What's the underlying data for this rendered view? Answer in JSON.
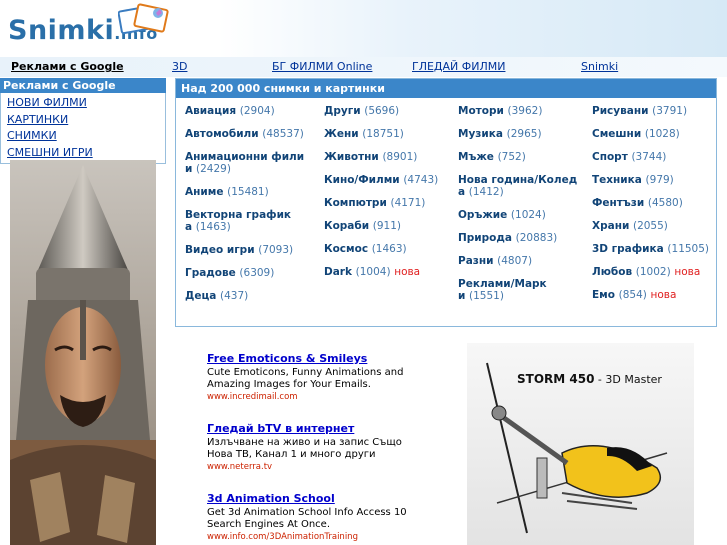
{
  "header": {
    "logo_main": "Snimki",
    "logo_tld": ".info"
  },
  "nav": {
    "ads": "Реклами с Google",
    "links": [
      "3D",
      "БГ ФИЛМИ Online",
      "ГЛЕДАЙ ФИЛМИ",
      "Snimki"
    ]
  },
  "sidebar": {
    "ads": "Реклами с Google",
    "items": [
      "НОВИ ФИЛМИ",
      "КАРТИНКИ",
      "СНИМКИ",
      "СМЕШНИ ИГРИ"
    ]
  },
  "panel": {
    "title": "Над 200 000 снимки и картинки",
    "columns": [
      [
        {
          "name": "Авиация",
          "count": "(2904)"
        },
        {
          "name": "Автомобили",
          "count": "(48537)"
        },
        {
          "name": "Анимационни фили",
          "name2": "и",
          "count": "(2429)"
        },
        {
          "name": "Аниме",
          "count": "(15481)"
        },
        {
          "name": "Векторна график",
          "name2": "а",
          "count": "(1463)"
        },
        {
          "name": "Видео игри",
          "count": "(7093)"
        },
        {
          "name": "Градове",
          "count": "(6309)"
        },
        {
          "name": "Деца",
          "count": "(437)"
        }
      ],
      [
        {
          "name": "Други",
          "count": "(5696)"
        },
        {
          "name": "Жени",
          "count": "(18751)"
        },
        {
          "name": "Животни",
          "count": "(8901)"
        },
        {
          "name": "Кино/Филми",
          "count": "(4743)"
        },
        {
          "name": "Компютри",
          "count": "(4171)"
        },
        {
          "name": "Кораби",
          "count": "(911)"
        },
        {
          "name": "Космос",
          "count": "(1463)"
        },
        {
          "name": "Dark",
          "count": "(1004)",
          "new": "нова"
        }
      ],
      [
        {
          "name": "Мотори",
          "count": "(3962)"
        },
        {
          "name": "Музика",
          "count": "(2965)"
        },
        {
          "name": "Мъже",
          "count": "(752)"
        },
        {
          "name": "Нова година/Колед",
          "name2": "а",
          "count": "(1412)"
        },
        {
          "name": "Оръжие",
          "count": "(1024)"
        },
        {
          "name": "Природа",
          "count": "(20883)"
        },
        {
          "name": "Разни",
          "count": "(4807)"
        },
        {
          "name": "Реклами/Марк",
          "name2": "и",
          "count": "(1551)"
        }
      ],
      [
        {
          "name": "Рисувани",
          "count": "(3791)"
        },
        {
          "name": "Смешни",
          "count": "(1028)"
        },
        {
          "name": "Спорт",
          "count": "(3744)"
        },
        {
          "name": "Техника",
          "count": "(979)"
        },
        {
          "name": "Фентъзи",
          "count": "(4580)"
        },
        {
          "name": "Храни",
          "count": "(2055)"
        },
        {
          "name": "3D графика",
          "count": "(11505)"
        },
        {
          "name": "Любов",
          "count": "(1002)",
          "new": "нова"
        },
        {
          "name": "Емо",
          "count": "(854)",
          "new": "нова"
        }
      ]
    ]
  },
  "ads": [
    {
      "title": "Free Emoticons & Smileys",
      "desc": "Cute Emoticons, Funny Animations and Amazing Images for Your Emails.",
      "url": "www.incredimail.com"
    },
    {
      "title": "Гледай bTV в интернет",
      "desc": "Излъчване на живо и на запис Също Нова ТВ, Канал 1 и много други",
      "url": "www.neterra.tv"
    },
    {
      "title": "3d Animation School",
      "desc": "Get 3d Animation School Info Access 10 Search Engines At Once.",
      "url": "www.info.com/3DAnimationTraining"
    }
  ],
  "banner": {
    "model": "STORM 450",
    "subtitle": " - 3D Master"
  }
}
